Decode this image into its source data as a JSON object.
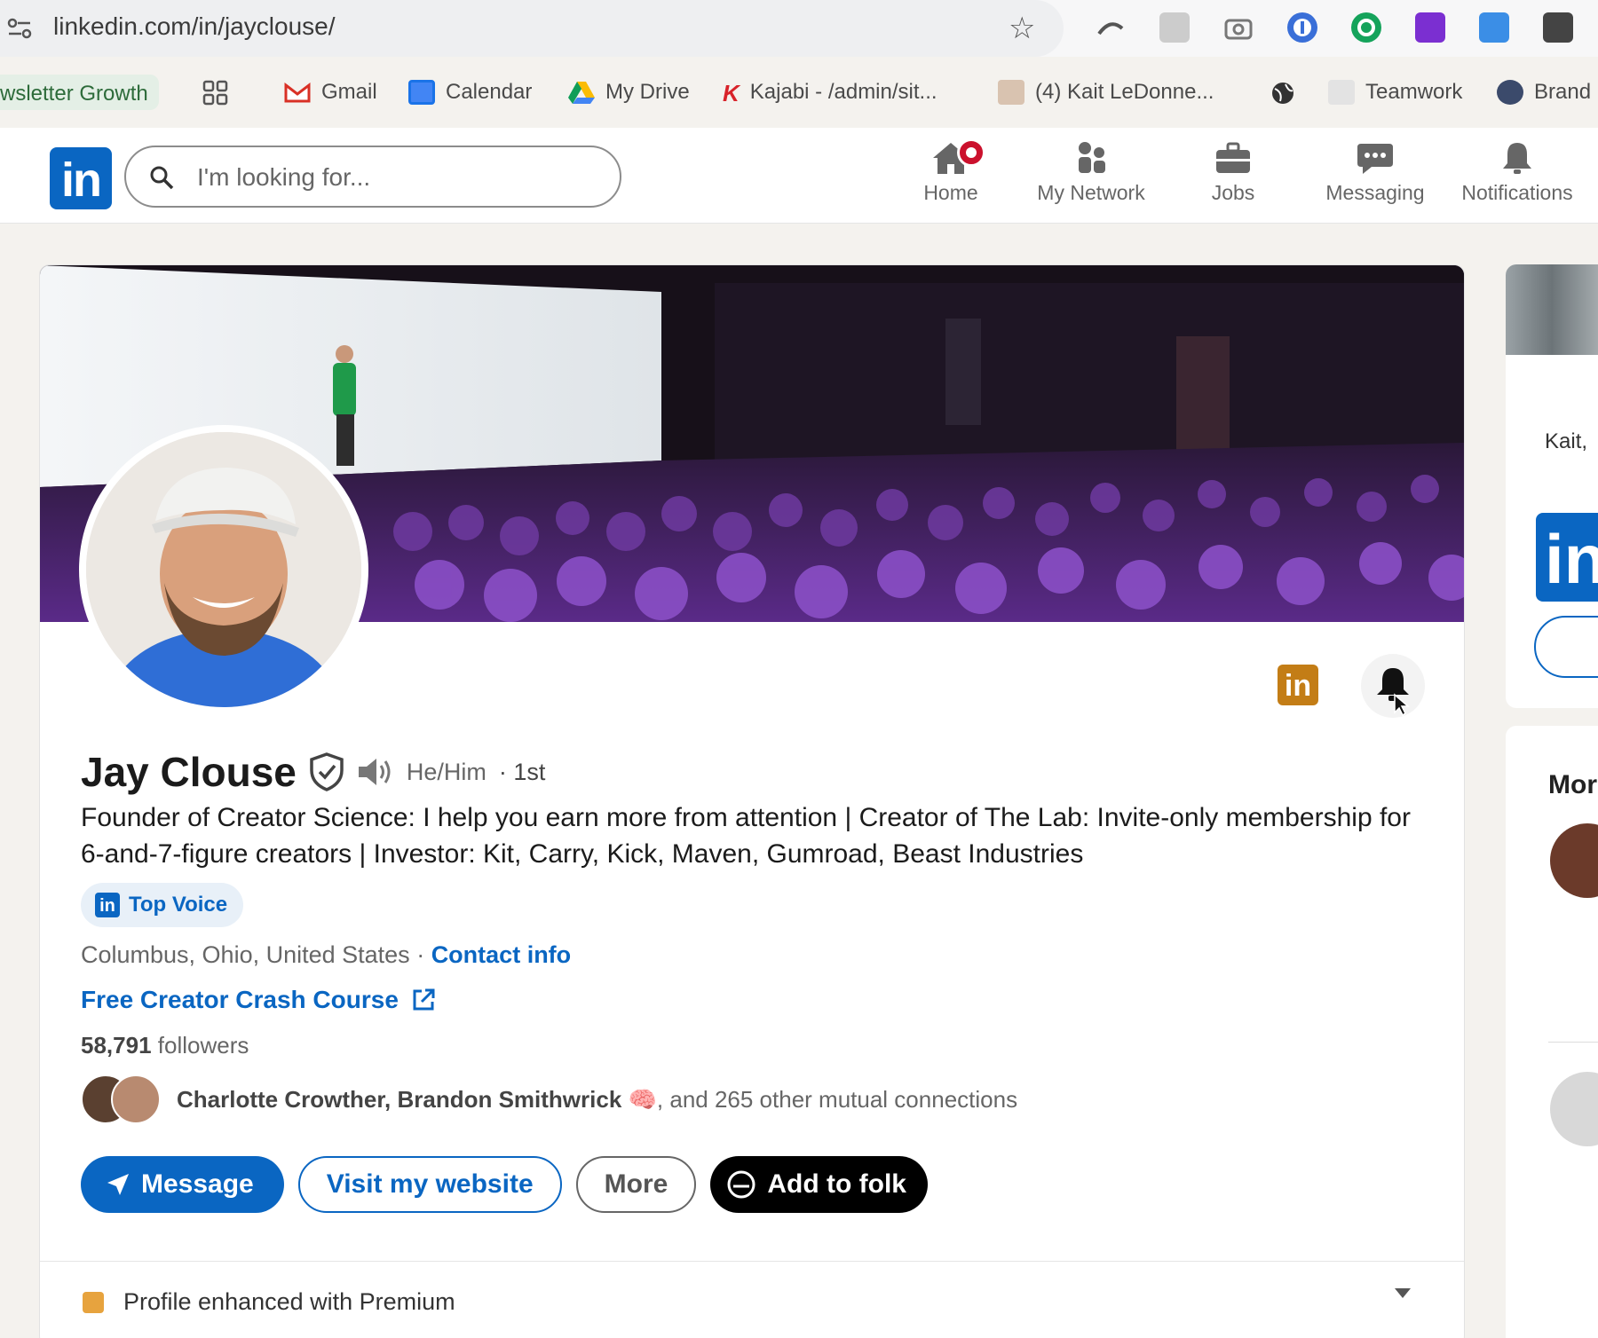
{
  "browser": {
    "url": "linkedin.com/in/jayclouse/",
    "bookmarks": [
      {
        "label": "wsletter Growth"
      },
      {
        "label": "Gmail"
      },
      {
        "label": "Calendar"
      },
      {
        "label": "My Drive"
      },
      {
        "label": "Kajabi - /admin/sit..."
      },
      {
        "label": "(4) Kait LeDonne..."
      },
      {
        "label": "Teamwork"
      },
      {
        "label": "Brand"
      }
    ]
  },
  "nav": {
    "logo": "in",
    "search_placeholder": "I'm looking for...",
    "items": [
      {
        "label": "Home"
      },
      {
        "label": "My Network"
      },
      {
        "label": "Jobs"
      },
      {
        "label": "Messaging"
      },
      {
        "label": "Notifications"
      }
    ]
  },
  "profile": {
    "name": "Jay Clouse",
    "pronouns": "He/Him",
    "degree": "· 1st",
    "headline": "Founder of Creator Science: I help you earn more from attention | Creator of The Lab: Invite-only membership for 6-and-7-figure creators | Investor: Kit, Carry, Kick, Maven, Gumroad, Beast Industries",
    "top_voice": "Top Voice",
    "location": "Columbus, Ohio, United States",
    "location_sep": " · ",
    "contact_info": "Contact info",
    "website_link": "Free Creator Crash Course",
    "followers_count": "58,791",
    "followers_label": " followers",
    "mutual_names": "Charlotte Crowther, Brandon Smithwrick",
    "mutual_rest": ", and 265 other mutual connections",
    "top_icon_text": "in"
  },
  "actions": {
    "message": "Message",
    "visit_website": "Visit my website",
    "more": "More",
    "add_to_folk": "Add to folk"
  },
  "premium": {
    "label": "Profile enhanced with Premium"
  },
  "sidebar": {
    "greeting": "Kait,",
    "logo": "in",
    "more_title": "Mor"
  },
  "colors": {
    "linkedin_blue": "#0a66c2",
    "notification_red": "#cb112d",
    "premium_gold": "#c37d16"
  }
}
